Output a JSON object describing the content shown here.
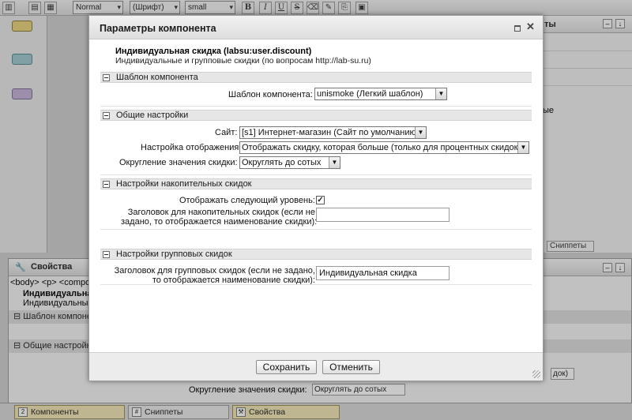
{
  "toolbar": {
    "style_select": "Normal",
    "font_select": "(Шрифт)",
    "size_select": "small",
    "bold": "B",
    "italic": "I",
    "underline": "U",
    "strike": "S"
  },
  "right_panel": {
    "head_suffix": "ты",
    "row_suffix": "ые",
    "snippets_tab": "Сниппеты"
  },
  "properties_panel": {
    "title": "Свойства",
    "breadcrumb": "<body> <p> <compo",
    "component_name": "Индивидуальная с",
    "component_desc": "Индивидуальные и",
    "section_template": "Шаблон компоне",
    "section_general": "Общие настройк",
    "rounding_label": "Округление значения скидки:",
    "rounding_value": "Округлять до сотых",
    "truncated_select": "док)"
  },
  "bottom_tabs": {
    "components": "Компоненты",
    "snippets": "Сниппеты",
    "properties": "Свойства"
  },
  "dialog": {
    "title": "Параметры компонента",
    "component_name": "Индивидуальная скидка (labsu:user.discount)",
    "component_desc": "Индивидуальные и групповые скидки (по вопросам http://lab-su.ru)",
    "sections": {
      "template": {
        "title": "Шаблон компонента",
        "template_label": "Шаблон компонента:",
        "template_value": "unismoke (Легкий шаблон)"
      },
      "general": {
        "title": "Общие настройки",
        "site_label": "Сайт:",
        "site_value": "[s1] Интернет-магазин (Сайт по умолчанию)",
        "display_label": "Настройка отображения:",
        "display_value": "Отображать скидку, которая больше (только для процентных скидок)",
        "rounding_label": "Округление значения скидки:",
        "rounding_value": "Округлять до сотых"
      },
      "accumulative": {
        "title": "Настройки накопительных скидок",
        "show_next_label": "Отображать следующий уровень:",
        "show_next_checked": "✓",
        "heading_label_line1": "Заголовок для накопительных скидок (если не",
        "heading_label_line2": "задано, то отображается наименование скидки):",
        "heading_value": ""
      },
      "group": {
        "title": "Настройки групповых скидок",
        "heading_label_line1": "Заголовок для групповых скидок (если не задано,",
        "heading_label_line2": "то отображается наименование скидки):",
        "heading_value": "Индивидуальная скидка"
      }
    },
    "buttons": {
      "save": "Сохранить",
      "cancel": "Отменить"
    }
  }
}
